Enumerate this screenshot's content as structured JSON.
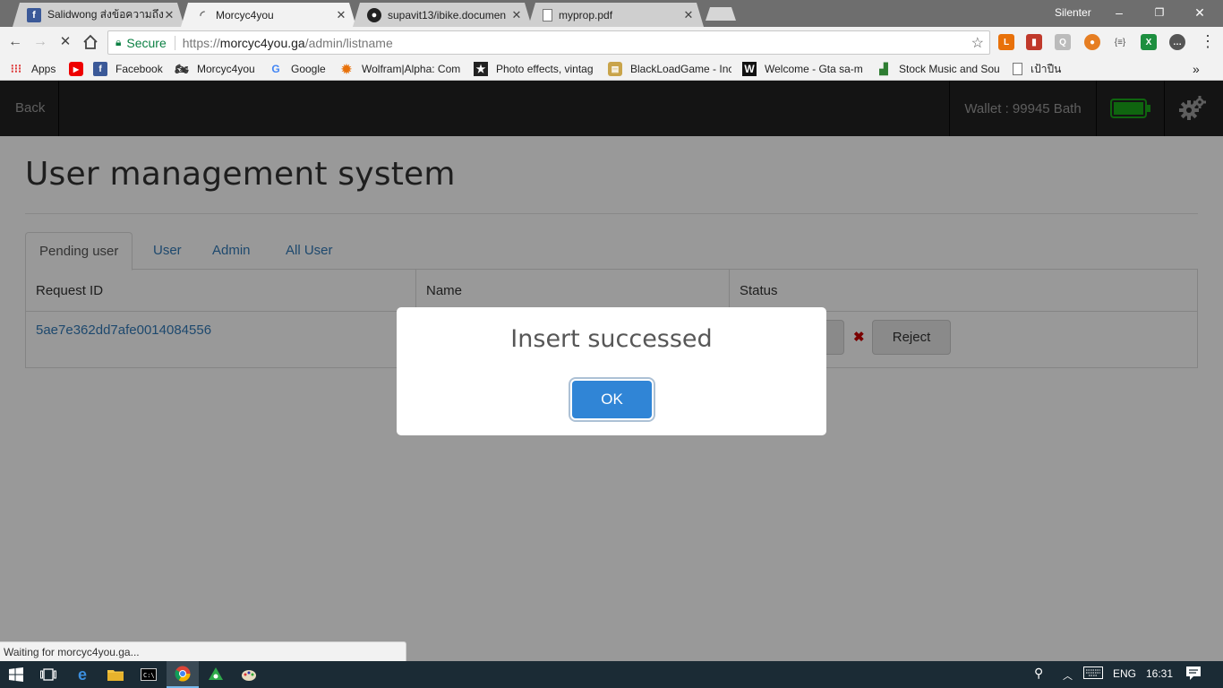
{
  "browser": {
    "tabs": [
      {
        "title": "Salidwong ส่งข้อความถึง Sr",
        "icon": "facebook-icon",
        "active": false
      },
      {
        "title": "Morcyc4you",
        "icon": "loading-spinner-icon",
        "active": true
      },
      {
        "title": "supavit13/ibike.documen",
        "icon": "github-icon",
        "active": false
      },
      {
        "title": "myprop.pdf",
        "icon": "document-icon",
        "active": false
      }
    ],
    "window_user": "Silenter",
    "window_controls": {
      "minimize": "–",
      "restore": "❐",
      "close": "✕"
    },
    "address": {
      "secure_label": "Secure",
      "scheme": "https://",
      "host": "morcyc4you.ga",
      "path": "/admin/listname"
    },
    "bookmarks": [
      {
        "label": "Apps",
        "icon": "apps-grid-icon"
      },
      {
        "label": "",
        "icon": "youtube-icon"
      },
      {
        "label": "Facebook",
        "icon": "facebook-icon"
      },
      {
        "label": "Morcyc4you",
        "icon": "motorcycle-icon"
      },
      {
        "label": "Google",
        "icon": "google-icon"
      },
      {
        "label": "Wolfram|Alpha: Com",
        "icon": "wolfram-icon"
      },
      {
        "label": "Photo effects, vintag",
        "icon": "star-icon"
      },
      {
        "label": "BlackLoadGame - Inc",
        "icon": "game-icon"
      },
      {
        "label": "Welcome - Gta sa-m",
        "icon": "w-icon"
      },
      {
        "label": "Stock Music and Sou",
        "icon": "music-icon"
      },
      {
        "label": "เป้าปืน",
        "icon": "page-icon"
      }
    ],
    "status_text": "Waiting for morcyc4you.ga..."
  },
  "page": {
    "nav": {
      "back_label": "Back",
      "wallet_label": "Wallet : 99945 Bath",
      "battery_color": "#1aa81a"
    },
    "title": "User management system",
    "tabs": [
      {
        "label": "Pending user",
        "active": true
      },
      {
        "label": "User",
        "active": false
      },
      {
        "label": "Admin",
        "active": false
      },
      {
        "label": "All User",
        "active": false
      }
    ],
    "table": {
      "headers": [
        "Request ID",
        "Name",
        "Status"
      ],
      "rows": [
        {
          "request_id": "5ae7e362dd7afe0014084556",
          "reject_label": "Reject"
        }
      ]
    }
  },
  "modal": {
    "title": "Insert successed",
    "ok_label": "OK",
    "button_color": "#3085d6"
  },
  "taskbar": {
    "lang": "ENG",
    "time": "16:31"
  }
}
